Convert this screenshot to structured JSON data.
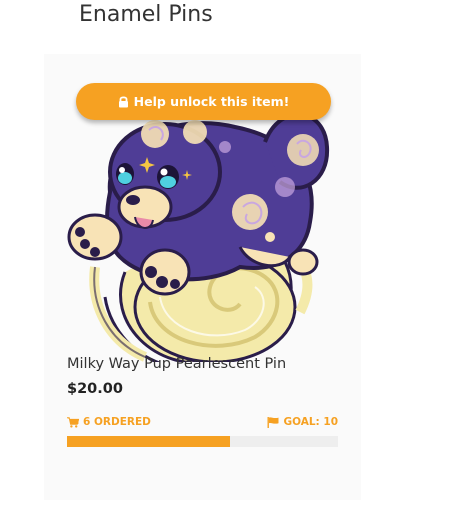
{
  "section": {
    "title": "Enamel Pins"
  },
  "product": {
    "unlock_label": "Help unlock this item!",
    "name": "Milky Way Pup Pearlescent Pin",
    "price": "$20.00",
    "ordered_text": "6 ORDERED",
    "goal_text": "GOAL: 10",
    "progress_fraction": 0.6,
    "image_icon": "milky-way-pup-illustration"
  },
  "icons": {
    "lock": "lock-icon",
    "cart": "cart-icon",
    "flag": "flag-icon"
  },
  "colors": {
    "accent": "#f6a122",
    "text": "#333333",
    "track": "#eeeeee",
    "card_bg": "#fafafa",
    "pin_purple": "#4f3d96",
    "pin_cream": "#f8e3b6",
    "pin_yellow": "#f4eaaa",
    "pin_outline": "#2a1d4a"
  }
}
